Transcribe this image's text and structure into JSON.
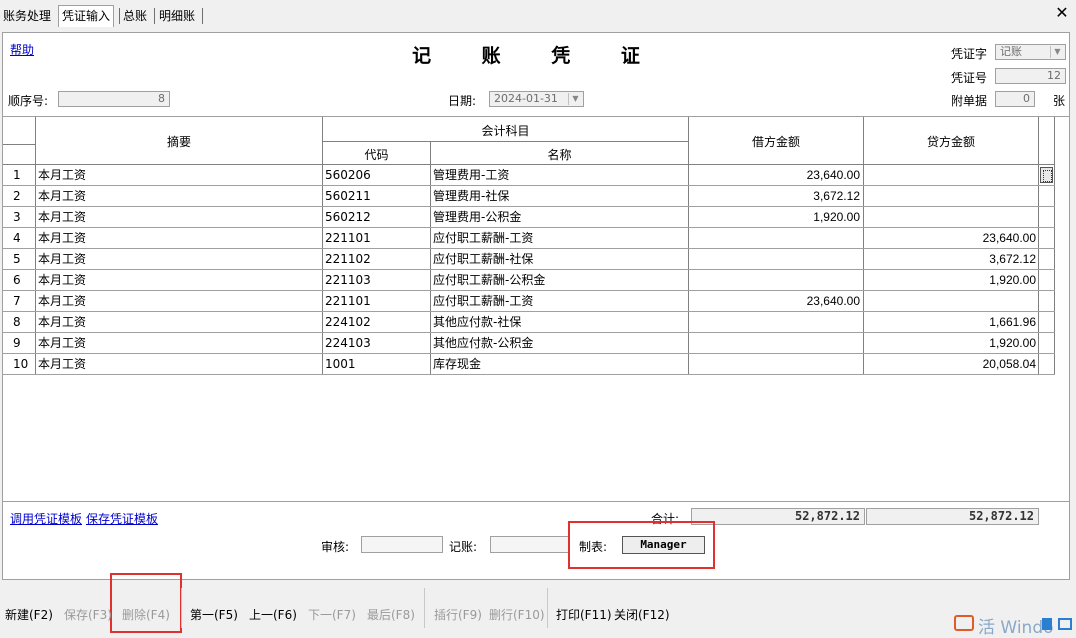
{
  "tabs": [
    {
      "label": "账务处理",
      "active": false
    },
    {
      "label": "凭证输入",
      "active": true
    },
    {
      "label": "总账",
      "active": false
    },
    {
      "label": "明细账",
      "active": false
    }
  ],
  "close_glyph": "✕",
  "help_link": "帮助",
  "title": "记 账 凭 证",
  "voucher_type": {
    "label": "凭证字",
    "value": "记账"
  },
  "voucher_no": {
    "label": "凭证号",
    "value": "12"
  },
  "seq_no": {
    "label": "顺序号:",
    "value": "8"
  },
  "date": {
    "label": "日期:",
    "value": "2024-01-31"
  },
  "attachments": {
    "label": "附单据",
    "value": "0",
    "unit": "张"
  },
  "grid": {
    "headers": {
      "summary": "摘要",
      "account": "会计科目",
      "code": "代码",
      "name": "名称",
      "debit": "借方金额",
      "credit": "贷方金额"
    },
    "rows": [
      {
        "no": "1",
        "summary": "本月工资",
        "code": "560206",
        "name": "管理费用-工资",
        "debit": "23,640.00",
        "credit": ""
      },
      {
        "no": "2",
        "summary": "本月工资",
        "code": "560211",
        "name": "管理费用-社保",
        "debit": "3,672.12",
        "credit": ""
      },
      {
        "no": "3",
        "summary": "本月工资",
        "code": "560212",
        "name": "管理费用-公积金",
        "debit": "1,920.00",
        "credit": ""
      },
      {
        "no": "4",
        "summary": "本月工资",
        "code": "221101",
        "name": "应付职工薪酬-工资",
        "debit": "",
        "credit": "23,640.00"
      },
      {
        "no": "5",
        "summary": "本月工资",
        "code": "221102",
        "name": "应付职工薪酬-社保",
        "debit": "",
        "credit": "3,672.12"
      },
      {
        "no": "6",
        "summary": "本月工资",
        "code": "221103",
        "name": "应付职工薪酬-公积金",
        "debit": "",
        "credit": "1,920.00"
      },
      {
        "no": "7",
        "summary": "本月工资",
        "code": "221101",
        "name": "应付职工薪酬-工资",
        "debit": "23,640.00",
        "credit": ""
      },
      {
        "no": "8",
        "summary": "本月工资",
        "code": "224102",
        "name": "其他应付款-社保",
        "debit": "",
        "credit": "1,661.96"
      },
      {
        "no": "9",
        "summary": "本月工资",
        "code": "224103",
        "name": "其他应付款-公积金",
        "debit": "",
        "credit": "1,920.00"
      },
      {
        "no": "10",
        "summary": "本月工资",
        "code": "1001",
        "name": "库存现金",
        "debit": "",
        "credit": "20,058.04"
      }
    ]
  },
  "template_links": {
    "use": "调用凭证模板",
    "save": "保存凭证模板"
  },
  "totals": {
    "label": "合计:",
    "debit": "52,872.12",
    "credit": "52,872.12"
  },
  "signatures": {
    "review": "审核:",
    "post": "记账:",
    "maker_label": "制表:",
    "maker_value": "Manager"
  },
  "toolbar": {
    "new": "新建(F2)",
    "save": "保存(F3)",
    "delete": "删除(F4)",
    "first": "第一(F5)",
    "prev": "上一(F6)",
    "next": "下一(F7)",
    "last": "最后(F8)",
    "insert": "插行(F9)",
    "delete_row": "删行(F10)",
    "print": "打印(F11)",
    "close": "关闭(F12)"
  },
  "ime": {
    "text": "活 Windo"
  },
  "colors": {
    "highlight_red": "#e03030",
    "link": "#0000cc",
    "disabled": "#9a9a9a"
  }
}
